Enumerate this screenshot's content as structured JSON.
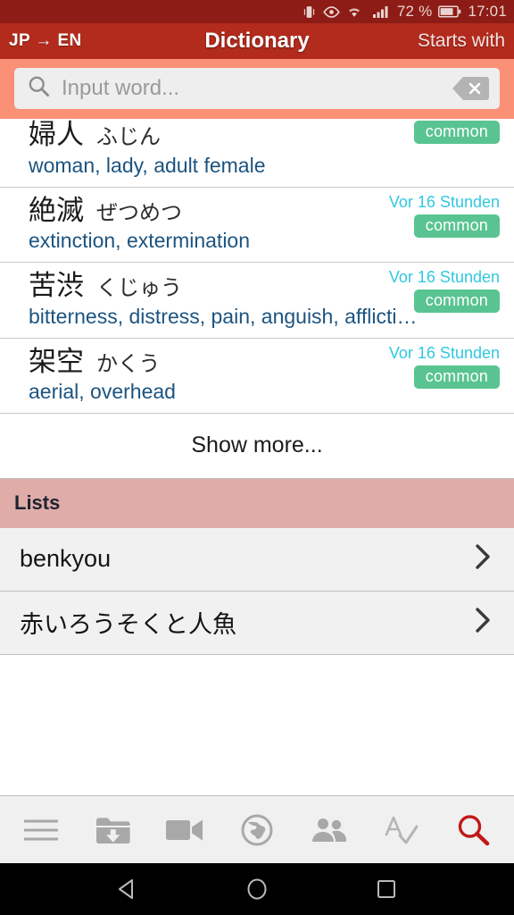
{
  "status_bar": {
    "icons": [
      "vibrate-icon",
      "eye-icon",
      "wifi-icon",
      "signal-icon"
    ],
    "battery_percent": "72 %",
    "time": "17:01"
  },
  "app_bar": {
    "language_pair": "JP → EN",
    "title": "Dictionary",
    "search_mode": "Starts with"
  },
  "search": {
    "placeholder": "Input word...",
    "value": "",
    "search_icon": "search-icon",
    "clear_icon": "clear-backspace-icon"
  },
  "results": {
    "entries": [
      {
        "kanji": "婦人",
        "kana": "ふじん",
        "gloss": "woman, lady, adult female",
        "time": "",
        "badge": "common"
      },
      {
        "kanji": "絶滅",
        "kana": "ぜつめつ",
        "gloss": "extinction, extermination",
        "time": "Vor 16 Stunden",
        "badge": "common"
      },
      {
        "kanji": "苦渋",
        "kana": "くじゅう",
        "gloss": "bitterness, distress, pain, anguish, afflicti…",
        "time": "Vor 16 Stunden",
        "badge": "common"
      },
      {
        "kanji": "架空",
        "kana": "かくう",
        "gloss": "aerial, overhead",
        "time": "Vor 16 Stunden",
        "badge": "common"
      }
    ],
    "show_more": "Show more..."
  },
  "lists": {
    "header": "Lists",
    "items": [
      {
        "label": "benkyou",
        "chevron": "chevron-right-icon"
      },
      {
        "label": "赤いろうそくと人魚",
        "chevron": "chevron-right-icon"
      }
    ]
  },
  "toolbar": {
    "buttons": [
      {
        "icon": "menu-hamburger-icon",
        "active": false
      },
      {
        "icon": "folder-download-icon",
        "active": false
      },
      {
        "icon": "video-camera-icon",
        "active": false
      },
      {
        "icon": "globe-icon",
        "active": false
      },
      {
        "icon": "people-icon",
        "active": false
      },
      {
        "icon": "spellcheck-icon",
        "active": false
      },
      {
        "icon": "search-icon",
        "active": true
      }
    ]
  },
  "nav_bar": {
    "back": "back-triangle-icon",
    "home": "home-circle-icon",
    "recents": "recents-square-icon"
  },
  "colors": {
    "status_bar": "#8c1c15",
    "app_bar": "#b22b1d",
    "search_band": "#fa9177",
    "badge_green": "#59c491",
    "time_cyan": "#31c8e0",
    "gloss_blue": "#1c5480",
    "section_pink": "#dfaca8",
    "active_search_red": "#c01a18"
  }
}
